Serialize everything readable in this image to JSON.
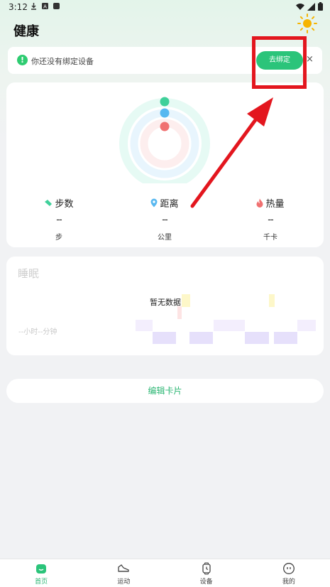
{
  "status_bar": {
    "time": "3:12"
  },
  "header": {
    "title": "健康"
  },
  "banner": {
    "text": "你还没有绑定设备",
    "bind_label": "去绑定",
    "close_label": "×"
  },
  "activity": {
    "metrics": [
      {
        "label": "步数",
        "value": "--",
        "unit": "步",
        "icon": "shoe-icon",
        "color": "#3fd09a"
      },
      {
        "label": "距离",
        "value": "--",
        "unit": "公里",
        "icon": "location-pin-icon",
        "color": "#58b8f0"
      },
      {
        "label": "热量",
        "value": "--",
        "unit": "千卡",
        "icon": "flame-icon",
        "color": "#f07070"
      }
    ],
    "ring_colors": [
      "#3fd09a",
      "#58b8f0",
      "#f07070"
    ]
  },
  "sleep": {
    "title": "睡眠",
    "no_data": "暂无数据",
    "duration": "--小时--分钟"
  },
  "edit_card_label": "编辑卡片",
  "bottom_nav": [
    {
      "label": "首页",
      "icon": "home-icon",
      "active": true
    },
    {
      "label": "运动",
      "icon": "sneaker-icon",
      "active": false
    },
    {
      "label": "设备",
      "icon": "watch-icon",
      "active": false
    },
    {
      "label": "我的",
      "icon": "profile-face-icon",
      "active": false
    }
  ],
  "colors": {
    "accent": "#2bc47a",
    "annotation": "#e3161e"
  }
}
